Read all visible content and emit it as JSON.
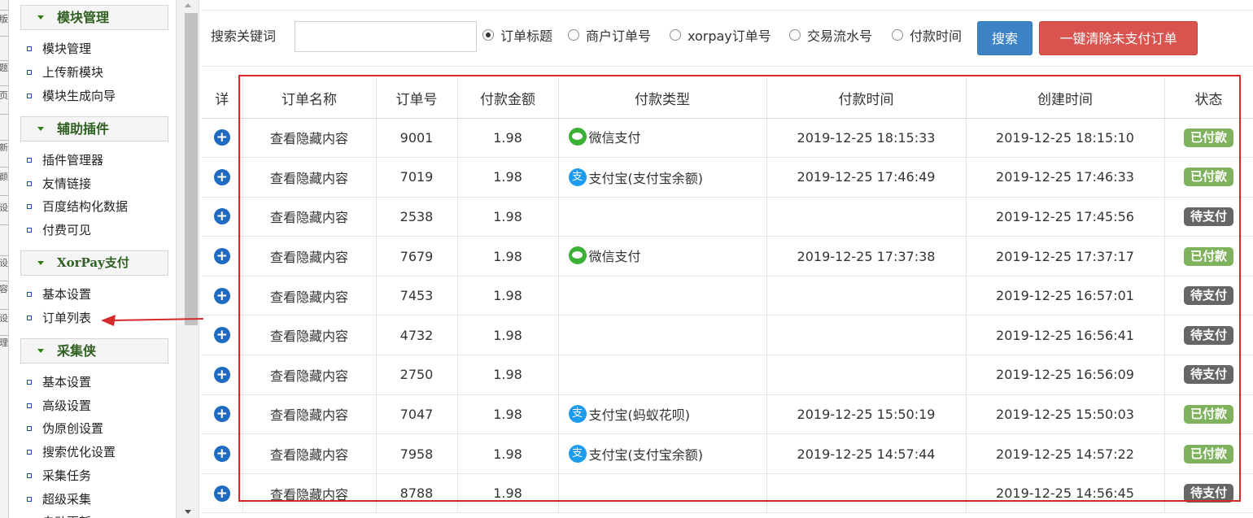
{
  "left_strip": {
    "fragments": [
      "版",
      "题",
      "页",
      "新",
      "颜",
      "设",
      "设",
      "容",
      "设",
      "理"
    ]
  },
  "sidebar": {
    "groups": [
      {
        "title": "模块管理",
        "items": [
          "模块管理",
          "上传新模块",
          "模块生成向导"
        ]
      },
      {
        "title": "辅助插件",
        "items": [
          "插件管理器",
          "友情链接",
          "百度结构化数据",
          "付费可见"
        ]
      },
      {
        "title": "XorPay支付",
        "items": [
          "基本设置",
          "订单列表"
        ]
      },
      {
        "title": "采集侠",
        "items": [
          "基本设置",
          "高级设置",
          "伪原创设置",
          "搜索优化设置",
          "采集任务",
          "超级采集",
          "自动更新"
        ]
      }
    ]
  },
  "search": {
    "label": "搜索关键词",
    "value": "",
    "options": [
      {
        "label": "订单标题",
        "checked": true
      },
      {
        "label": "商户订单号",
        "checked": false
      },
      {
        "label": "xorpay订单号",
        "checked": false
      },
      {
        "label": "交易流水号",
        "checked": false
      },
      {
        "label": "付款时间",
        "checked": false
      }
    ],
    "search_button": "搜索",
    "clear_button": "一键清除未支付订单"
  },
  "table": {
    "columns": [
      "详",
      "订单名称",
      "订单号",
      "付款金额",
      "付款类型",
      "付款时间",
      "创建时间",
      "状态"
    ],
    "expand_icon": "+",
    "rows": [
      {
        "name": "查看隐藏内容",
        "order_no": "9001",
        "amount": "1.98",
        "pay_icon": "wechat",
        "pay_type": "微信支付",
        "pay_time": "2019-12-25 18:15:33",
        "created": "2019-12-25 18:15:10",
        "status": "已付款",
        "status_kind": "paid"
      },
      {
        "name": "查看隐藏内容",
        "order_no": "7019",
        "amount": "1.98",
        "pay_icon": "alipay",
        "pay_type": "支付宝(支付宝余额)",
        "pay_time": "2019-12-25 17:46:49",
        "created": "2019-12-25 17:46:33",
        "status": "已付款",
        "status_kind": "paid"
      },
      {
        "name": "查看隐藏内容",
        "order_no": "2538",
        "amount": "1.98",
        "pay_icon": "",
        "pay_type": "",
        "pay_time": "",
        "created": "2019-12-25 17:45:56",
        "status": "待支付",
        "status_kind": "unpaid"
      },
      {
        "name": "查看隐藏内容",
        "order_no": "7679",
        "amount": "1.98",
        "pay_icon": "wechat",
        "pay_type": "微信支付",
        "pay_time": "2019-12-25 17:37:38",
        "created": "2019-12-25 17:37:17",
        "status": "已付款",
        "status_kind": "paid"
      },
      {
        "name": "查看隐藏内容",
        "order_no": "7453",
        "amount": "1.98",
        "pay_icon": "",
        "pay_type": "",
        "pay_time": "",
        "created": "2019-12-25 16:57:01",
        "status": "待支付",
        "status_kind": "unpaid"
      },
      {
        "name": "查看隐藏内容",
        "order_no": "4732",
        "amount": "1.98",
        "pay_icon": "",
        "pay_type": "",
        "pay_time": "",
        "created": "2019-12-25 16:56:41",
        "status": "待支付",
        "status_kind": "unpaid"
      },
      {
        "name": "查看隐藏内容",
        "order_no": "2750",
        "amount": "1.98",
        "pay_icon": "",
        "pay_type": "",
        "pay_time": "",
        "created": "2019-12-25 16:56:09",
        "status": "待支付",
        "status_kind": "unpaid"
      },
      {
        "name": "查看隐藏内容",
        "order_no": "7047",
        "amount": "1.98",
        "pay_icon": "alipay",
        "pay_type": "支付宝(蚂蚁花呗)",
        "pay_time": "2019-12-25 15:50:19",
        "created": "2019-12-25 15:50:03",
        "status": "已付款",
        "status_kind": "paid"
      },
      {
        "name": "查看隐藏内容",
        "order_no": "7958",
        "amount": "1.98",
        "pay_icon": "alipay",
        "pay_type": "支付宝(支付宝余额)",
        "pay_time": "2019-12-25 14:57:44",
        "created": "2019-12-25 14:57:22",
        "status": "已付款",
        "status_kind": "paid"
      },
      {
        "name": "查看隐藏内容",
        "order_no": "8788",
        "amount": "1.98",
        "pay_icon": "",
        "pay_type": "",
        "pay_time": "",
        "created": "2019-12-25 14:56:45",
        "status": "待支付",
        "status_kind": "unpaid"
      }
    ]
  },
  "colors": {
    "paid": "#7fb25c",
    "unpaid": "#666666",
    "search_button": "#3c83c6",
    "clear_button": "#d9534f",
    "annotation": "#d42a2a"
  }
}
